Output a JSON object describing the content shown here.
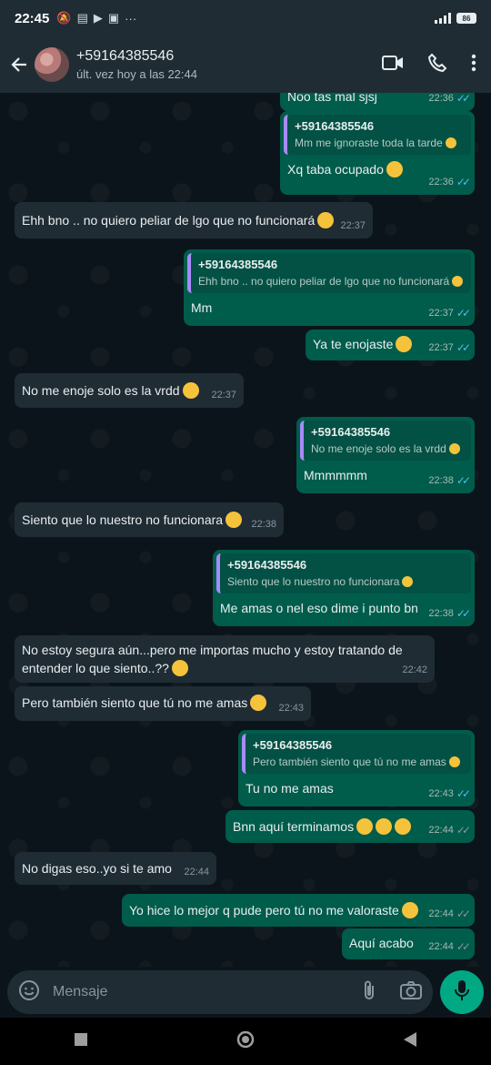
{
  "status": {
    "time": "22:45",
    "battery": "86"
  },
  "header": {
    "name": "+59164385546",
    "subtitle": "últ. vez hoy a las 22:44"
  },
  "messages": [
    {
      "text": "Noo tas mal sjsj",
      "time": "22:36"
    },
    {
      "quote_name": "+59164385546",
      "quote_text": "Mm me ignoraste toda la tarde",
      "text": "Xq taba  ocupado",
      "time": "22:36"
    },
    {
      "text": "Ehh bno .. no quiero peliar de lgo que no funcionará",
      "time": "22:37"
    },
    {
      "quote_name": "+59164385546",
      "quote_text": "Ehh bno .. no quiero peliar de lgo que no funcionará",
      "text": "Mm",
      "time": "22:37"
    },
    {
      "text": "Ya te enojaste",
      "time": "22:37"
    },
    {
      "text": "No me enoje solo es la vrdd",
      "time": "22:37"
    },
    {
      "quote_name": "+59164385546",
      "quote_text": "No me enoje solo es la vrdd",
      "text": "Mmmmmm",
      "time": "22:38"
    },
    {
      "text": "Siento que lo nuestro no funcionara",
      "time": "22:38"
    },
    {
      "quote_name": "+59164385546",
      "quote_text": "Siento que lo nuestro no funcionara",
      "text": "Me amas o nel eso dime i punto bn",
      "time": "22:38"
    },
    {
      "text": "No estoy segura aún...pero me importas mucho y estoy tratando de entender lo que siento..??",
      "time": "22:42"
    },
    {
      "text": "Pero también siento que tú no me amas",
      "time": "22:43"
    },
    {
      "quote_name": "+59164385546",
      "quote_text": "Pero también siento que tú no me amas",
      "text": "Tu no me amas",
      "time": "22:43"
    },
    {
      "text": "Bnn aquí terminamos",
      "time": "22:44"
    },
    {
      "text": "No digas eso..yo si te amo",
      "time": "22:44"
    },
    {
      "text": "Yo hice lo mejor q pude pero tú no me valoraste",
      "time": "22:44"
    },
    {
      "text": "Aquí acabo",
      "time": "22:44"
    }
  ],
  "composer": {
    "placeholder": "Mensaje"
  },
  "colors": {
    "incoming": "#1f2c34",
    "outgoing": "#005c4b",
    "accent": "#00a884",
    "read_tick": "#53bdeb"
  },
  "icons": [
    "back-arrow-icon",
    "video-call-icon",
    "phone-icon",
    "more-icon",
    "emoji-icon",
    "attach-icon",
    "camera-icon",
    "mic-icon"
  ]
}
